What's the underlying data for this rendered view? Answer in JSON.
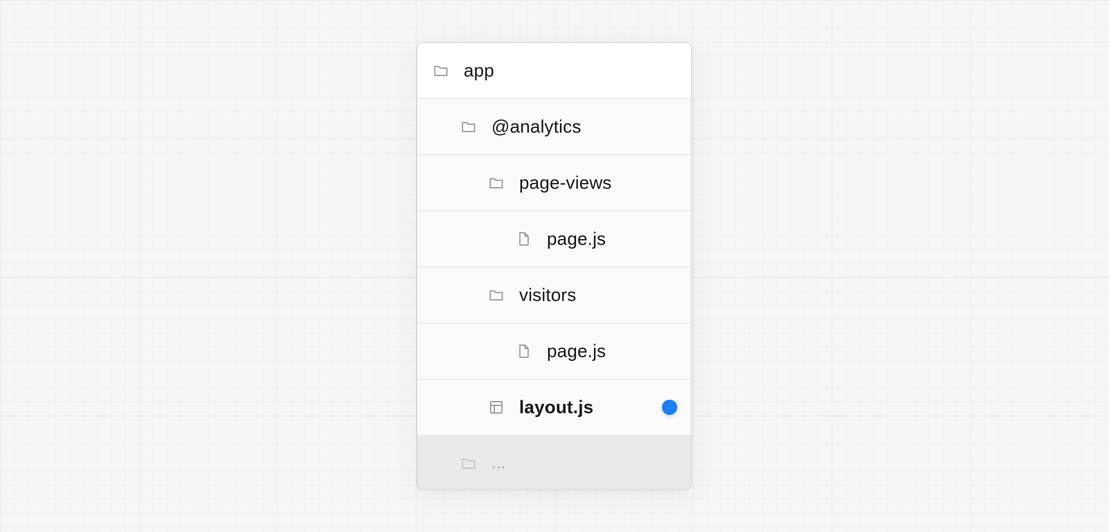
{
  "tree": {
    "rows": [
      {
        "label": "app",
        "icon": "folder-icon",
        "level": 0
      },
      {
        "label": "@analytics",
        "icon": "folder-icon",
        "level": 1
      },
      {
        "label": "page-views",
        "icon": "folder-icon",
        "level": 2
      },
      {
        "label": "page.js",
        "icon": "file-icon",
        "level": 3
      },
      {
        "label": "visitors",
        "icon": "folder-icon",
        "level": 2
      },
      {
        "label": "page.js",
        "icon": "file-icon",
        "level": 3
      },
      {
        "label": "layout.js",
        "icon": "layout-icon",
        "level": 2,
        "bold": true,
        "marker": true
      },
      {
        "label": "...",
        "icon": "folder-icon",
        "level": 1,
        "dimmed": true
      }
    ]
  },
  "colors": {
    "marker": "#1f7ef0",
    "icon_stroke": "#8a8a8a",
    "text": "#1a1a1a",
    "dim_text": "#a6a6a6"
  }
}
